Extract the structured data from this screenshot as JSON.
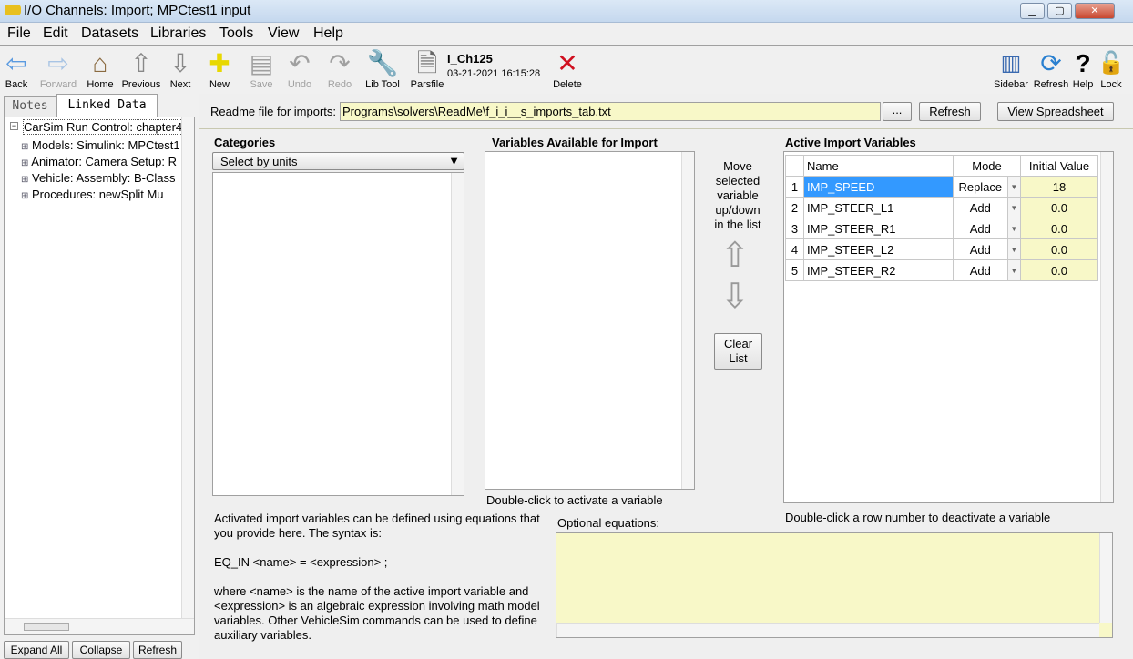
{
  "window": {
    "title": "I/O Channels: Import;   MPCtest1 input"
  },
  "menu": [
    "File",
    "Edit",
    "Datasets",
    "Libraries",
    "Tools",
    "View",
    "Help"
  ],
  "toolbar": {
    "back": "Back",
    "forward": "Forward",
    "home": "Home",
    "previous": "Previous",
    "next": "Next",
    "new": "New",
    "save": "Save",
    "undo": "Undo",
    "redo": "Redo",
    "libtool": "Lib Tool",
    "parsfile": "Parsfile",
    "dataset_name": "I_Ch125",
    "dataset_date": "03-21-2021 16:15:28",
    "delete": "Delete",
    "sidebar": "Sidebar",
    "refresh": "Refresh",
    "help": "Help",
    "lock": "Lock"
  },
  "left": {
    "tabs": [
      "Notes",
      "Linked Data"
    ],
    "tree_root": "CarSim Run Control: chapter4",
    "tree": [
      "Models: Simulink: MPCtest1",
      "Animator: Camera Setup: R",
      "Vehicle: Assembly: B-Class",
      "Procedures: newSplit Mu"
    ],
    "buttons": [
      "Expand All",
      "Collapse",
      "Refresh"
    ]
  },
  "readme": {
    "label": "Readme file for imports:",
    "value": "Programs\\solvers\\ReadMe\\f_i_i__s_imports_tab.txt",
    "browse": "...",
    "refresh": "Refresh",
    "view": "View Spreadsheet"
  },
  "categories": {
    "label": "Categories",
    "select": "Select by units"
  },
  "available": {
    "label": "Variables Available for Import",
    "hint": "Double-click to activate a variable"
  },
  "move": {
    "text": "Move selected variable up/down in the list",
    "clear": "Clear List"
  },
  "active": {
    "label": "Active Import Variables",
    "headers": [
      "Name",
      "Mode",
      "Initial Value"
    ],
    "rows": [
      {
        "n": "1",
        "name": "IMP_SPEED",
        "mode": "Replace",
        "init": "18"
      },
      {
        "n": "2",
        "name": "IMP_STEER_L1",
        "mode": "Add",
        "init": "0.0"
      },
      {
        "n": "3",
        "name": "IMP_STEER_R1",
        "mode": "Add",
        "init": "0.0"
      },
      {
        "n": "4",
        "name": "IMP_STEER_L2",
        "mode": "Add",
        "init": "0.0"
      },
      {
        "n": "5",
        "name": "IMP_STEER_R2",
        "mode": "Add",
        "init": "0.0"
      }
    ],
    "hint": "Double-click a row number to deactivate a variable"
  },
  "description": [
    "Activated import variables can be defined using equations that you provide here. The syntax is:",
    "EQ_IN <name> = <expression> ;",
    "where <name> is the name of the active import variable and <expression> is an algebraic expression involving math model variables. Other VehicleSim commands can be used to define auxiliary variables."
  ],
  "equations": {
    "label": "Optional equations:",
    "value": ""
  }
}
